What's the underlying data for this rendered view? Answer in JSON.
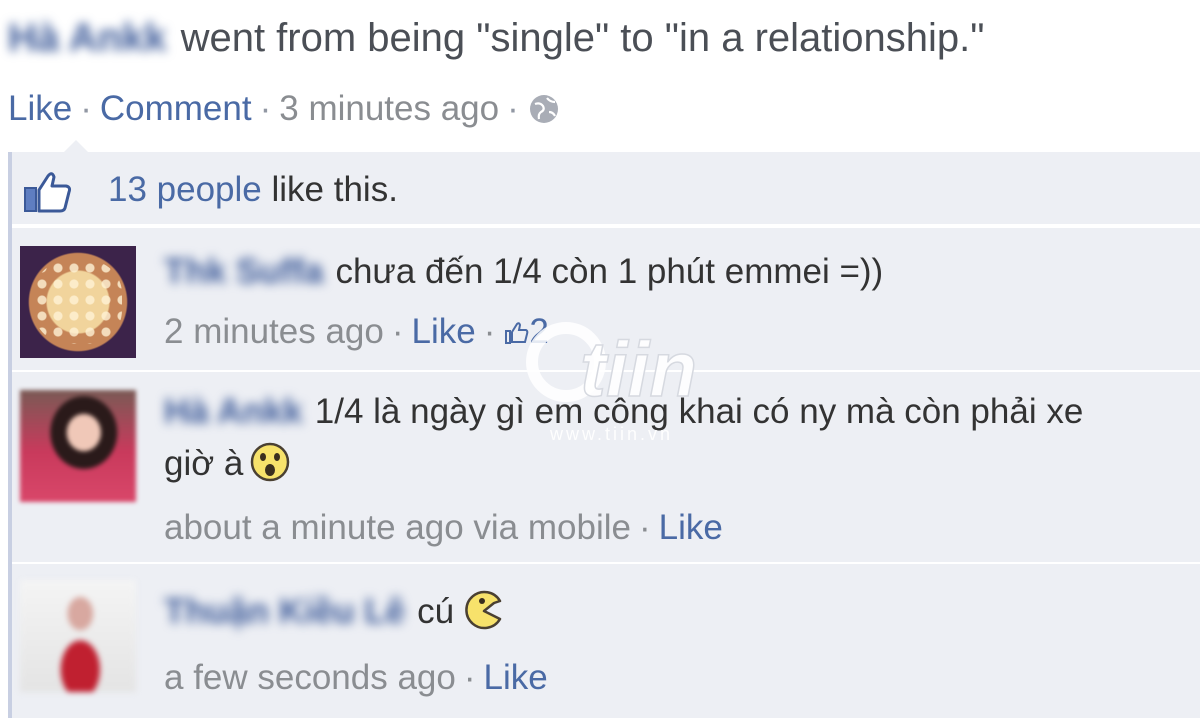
{
  "story": {
    "actor": "Hà Ankk",
    "text": "went from being \"single\" to \"in a relationship.\""
  },
  "actions": {
    "like": "Like",
    "comment": "Comment",
    "time": "3 minutes ago",
    "separator": "·"
  },
  "likes": {
    "count_text": "13 people",
    "suffix": " like this."
  },
  "comments": [
    {
      "author": "Thk Suffa",
      "text": "chưa đến 1/4 còn 1 phút emmei =))",
      "time": "2 minutes ago",
      "like": "Like",
      "like_count": "2"
    },
    {
      "author": "Hà Ankk",
      "text": "1/4 là ngày gì em công khai có ny mà còn phải xe",
      "text_line2": "giờ à",
      "time": "about a minute ago via mobile",
      "like": "Like"
    },
    {
      "author": "Thuận Kiều Lê",
      "text": "cú",
      "time": "a few seconds ago",
      "like": "Like"
    }
  ],
  "watermark": {
    "brand": "tiin",
    "url": "www.tiin.vn"
  },
  "colors": {
    "link": "#3b5998",
    "ufi_background": "#edeff4",
    "meta_gray": "#8a8d91"
  }
}
